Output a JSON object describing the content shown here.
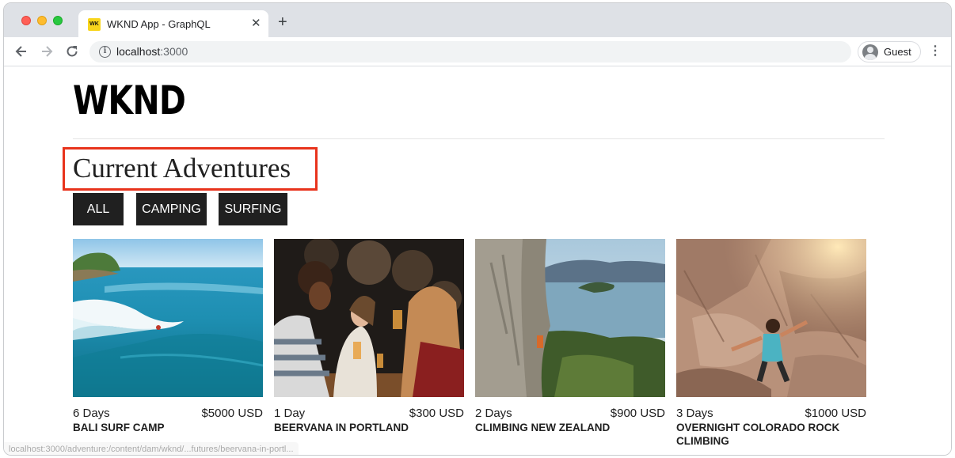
{
  "browser": {
    "tab_title": "WKND App - GraphQL",
    "tab_favicon_text": "WK",
    "url_host": "localhost",
    "url_port": ":3000",
    "profile_label": "Guest",
    "status_url": "localhost:3000/adventure:/content/dam/wknd/...futures/beervana-in-portl..."
  },
  "site": {
    "logo": "WKND",
    "heading": "Current Adventures",
    "filters": [
      "ALL",
      "CAMPING",
      "SURFING"
    ]
  },
  "adventures": [
    {
      "days": "6 Days",
      "price": "$5000 USD",
      "title": "BALI SURF CAMP",
      "image": "surf-wave"
    },
    {
      "days": "1 Day",
      "price": "$300 USD",
      "title": "BEERVANA IN PORTLAND",
      "image": "pub-friends"
    },
    {
      "days": "2 Days",
      "price": "$900 USD",
      "title": "CLIMBING NEW ZEALAND",
      "image": "cliff-lake"
    },
    {
      "days": "3 Days",
      "price": "$1000 USD",
      "title": "OVERNIGHT COLORADO ROCK CLIMBING",
      "image": "rock-climber"
    }
  ],
  "colors": {
    "highlight_border": "#e8331c",
    "filter_bg": "#202020",
    "tabstrip_bg": "#dee1e6"
  }
}
